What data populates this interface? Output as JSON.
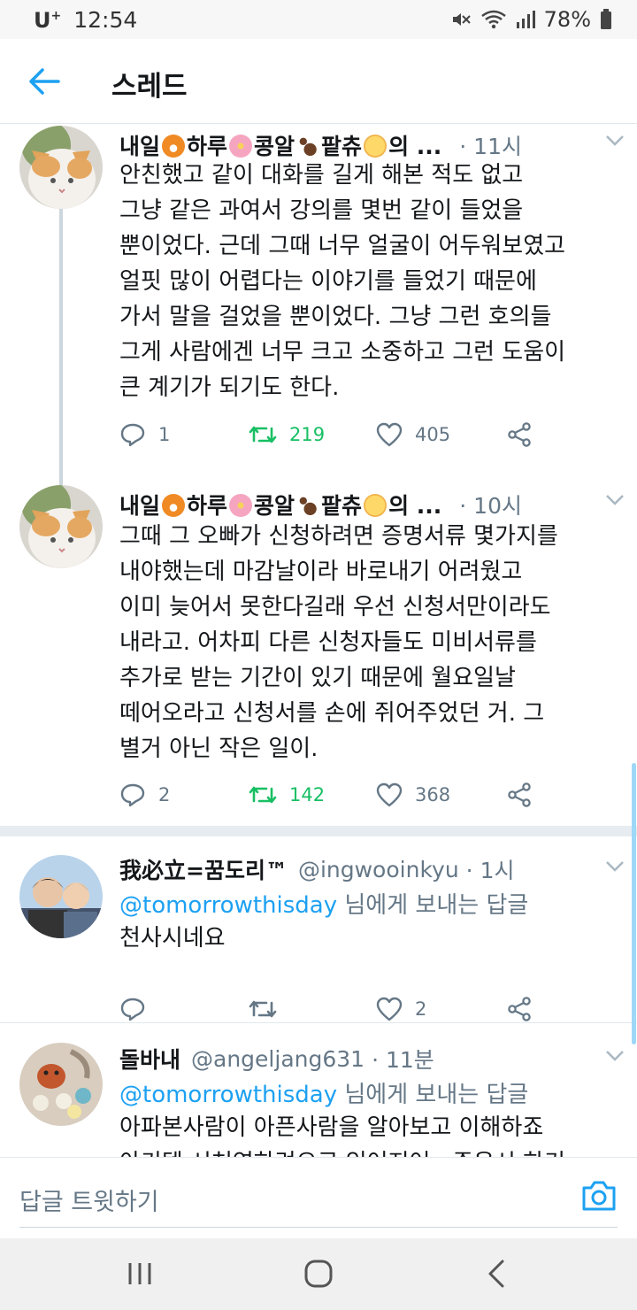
{
  "status_bar": {
    "carrier": "U",
    "carrier_sup": "+",
    "time": "12:54",
    "battery": "78%"
  },
  "header": {
    "title": "스레드",
    "back_icon": "arrow-left-icon"
  },
  "tweets": [
    {
      "name_parts": [
        "내일",
        "하루",
        "콩알",
        "팥츄",
        "의 ..."
      ],
      "time": "· 11시",
      "lines": [
        "안친했고 같이 대화를 길게 해본 적도 없고",
        "그냥 같은 과여서 강의를 몇번 같이 들었을",
        "뿐이었다. 근데 그때 너무 얼굴이 어두워보였고",
        "얼핏 많이 어렵다는 이야기를 들었기 때문에",
        "가서 말을 걸었을 뿐이었다. 그냥 그런 호의들",
        "그게 사람에겐 너무 크고 소중하고 그런 도움이",
        "큰 계기가 되기도 한다."
      ],
      "replies": "1",
      "retweets": "219",
      "likes": "405"
    },
    {
      "name_parts": [
        "내일",
        "하루",
        "콩알",
        "팥츄",
        "의 ..."
      ],
      "time": "· 10시",
      "lines": [
        "그때 그 오빠가 신청하려면 증명서류 몇가지를",
        "내야했는데 마감날이라 바로내기 어려웠고",
        "이미 늦어서 못한다길래 우선 신청서만이라도",
        "내라고. 어차피 다른 신청자들도 미비서류를",
        "추가로 받는 기간이 있기 때문에 월요일날",
        "떼어오라고 신청서를 손에 쥐어주었던 거. 그",
        "별거 아닌 작은 일이."
      ],
      "replies": "2",
      "retweets": "142",
      "likes": "368"
    },
    {
      "name": "我必立=꿈도리™",
      "handle": "@ingwooinkyu",
      "time": "· 1시",
      "reply_mention": "@tomorrowthisday",
      "reply_suffix": " 님에게 보내는 답글",
      "lines": [
        "천사시네요"
      ],
      "replies": "",
      "retweets": "",
      "likes": "2"
    },
    {
      "name": "돌바내",
      "handle": "@angeljang631",
      "time": "· 11분",
      "reply_mention": "@tomorrowthisday",
      "reply_suffix": " 님에게 보내는 답글",
      "lines": [
        "아파본사람이 아픈사람을 알아보고 이해하죠",
        "아키텍 시처연하려으로 있어지어 . 주은시 하기"
      ],
      "replies": "",
      "retweets": "",
      "likes": ""
    }
  ],
  "composer": {
    "placeholder": "답글 트윗하기"
  },
  "colors": {
    "accent": "#1da1f2",
    "retweet": "#17bf63",
    "muted": "#657786"
  }
}
